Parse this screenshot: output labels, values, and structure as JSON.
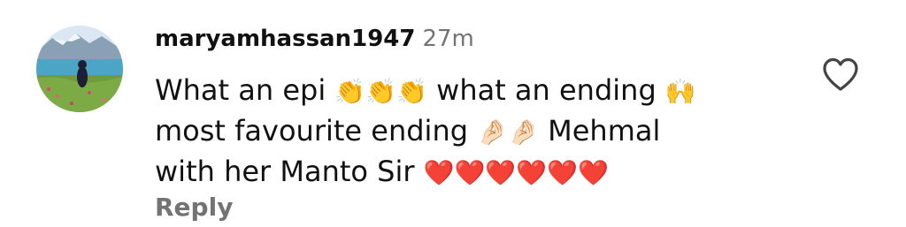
{
  "comment": {
    "username": "maryamhassan1947",
    "timestamp": "27m",
    "text_line1_a": "What an epi",
    "text_line1_emoji1": "👏👏👏",
    "text_line1_b": "what an ending",
    "text_line1_emoji2": "🙌",
    "text_line2_a": "most favourite ending",
    "text_line2_emoji": "🤌🏻🤌🏻",
    "text_line2_b": "Mehmal",
    "text_line3_a": "with her Manto Sir",
    "text_line3_emoji": "❤️❤️❤️❤️❤️❤️",
    "reply_label": "Reply",
    "like_icon": "heart-outline-icon"
  },
  "colors": {
    "username": "#111111",
    "secondary_text": "#737373",
    "heart_emoji": "#e0192f"
  }
}
